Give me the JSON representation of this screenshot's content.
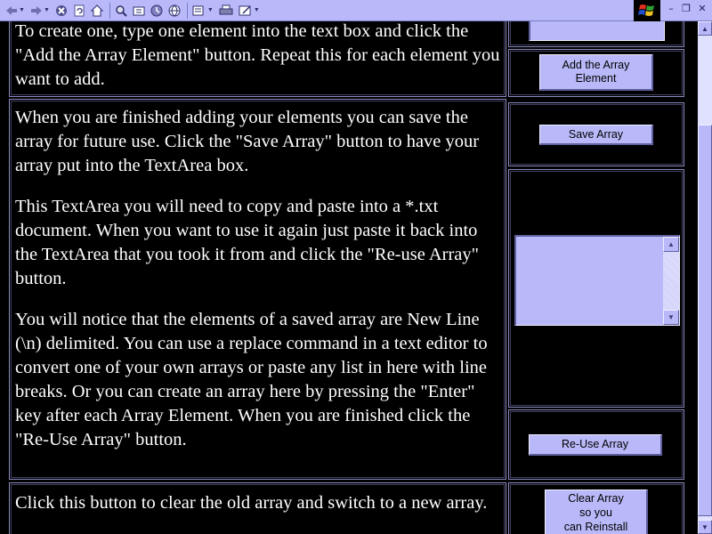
{
  "toolbar": {
    "icons": [
      "back-icon",
      "forward-icon",
      "stop-icon",
      "refresh-icon",
      "home-icon",
      "search-icon",
      "favorites-icon",
      "history-icon",
      "globe-icon",
      "mail-icon",
      "print-icon",
      "edit-icon"
    ],
    "window_controls": {
      "minimize": "–",
      "restore": "❐",
      "close": "✕"
    }
  },
  "rows": [
    {
      "paragraphs": [
        "To create one, type one element into the text box and click the \"Add the Array Element\" button. Repeat this for each element you want to add."
      ],
      "button_label": "Add the Array\nElement"
    },
    {
      "paragraphs": [
        "When you are finished adding your elements you can save the array for future use. Click the \"Save Array\" button to have your array put into the TextArea box.",
        "This TextArea you will need to copy and paste into a *.txt document. When you want to use it again just paste it back into the TextArea that you took it from and click the \"Re-use Array\" button.",
        "You will notice that the elements of a saved array are New Line (\\n) delimited. You can use a replace command in a text editor to convert one of your own arrays or paste any list in here with line breaks. Or you can create an array here by pressing the \"Enter\" key after each Array Element. When you are finished click the \"Re-Use Array\" button."
      ],
      "save_button_label": "Save Array",
      "reuse_button_label": "Re-Use Array"
    },
    {
      "paragraphs": [
        "Click this button to clear the old array and switch to a new array."
      ],
      "button_label": "Clear Array\nso you\ncan Reinstall"
    }
  ],
  "colors": {
    "accent": "#b9b9f9",
    "background": "#000000",
    "text": "#ffffff"
  }
}
